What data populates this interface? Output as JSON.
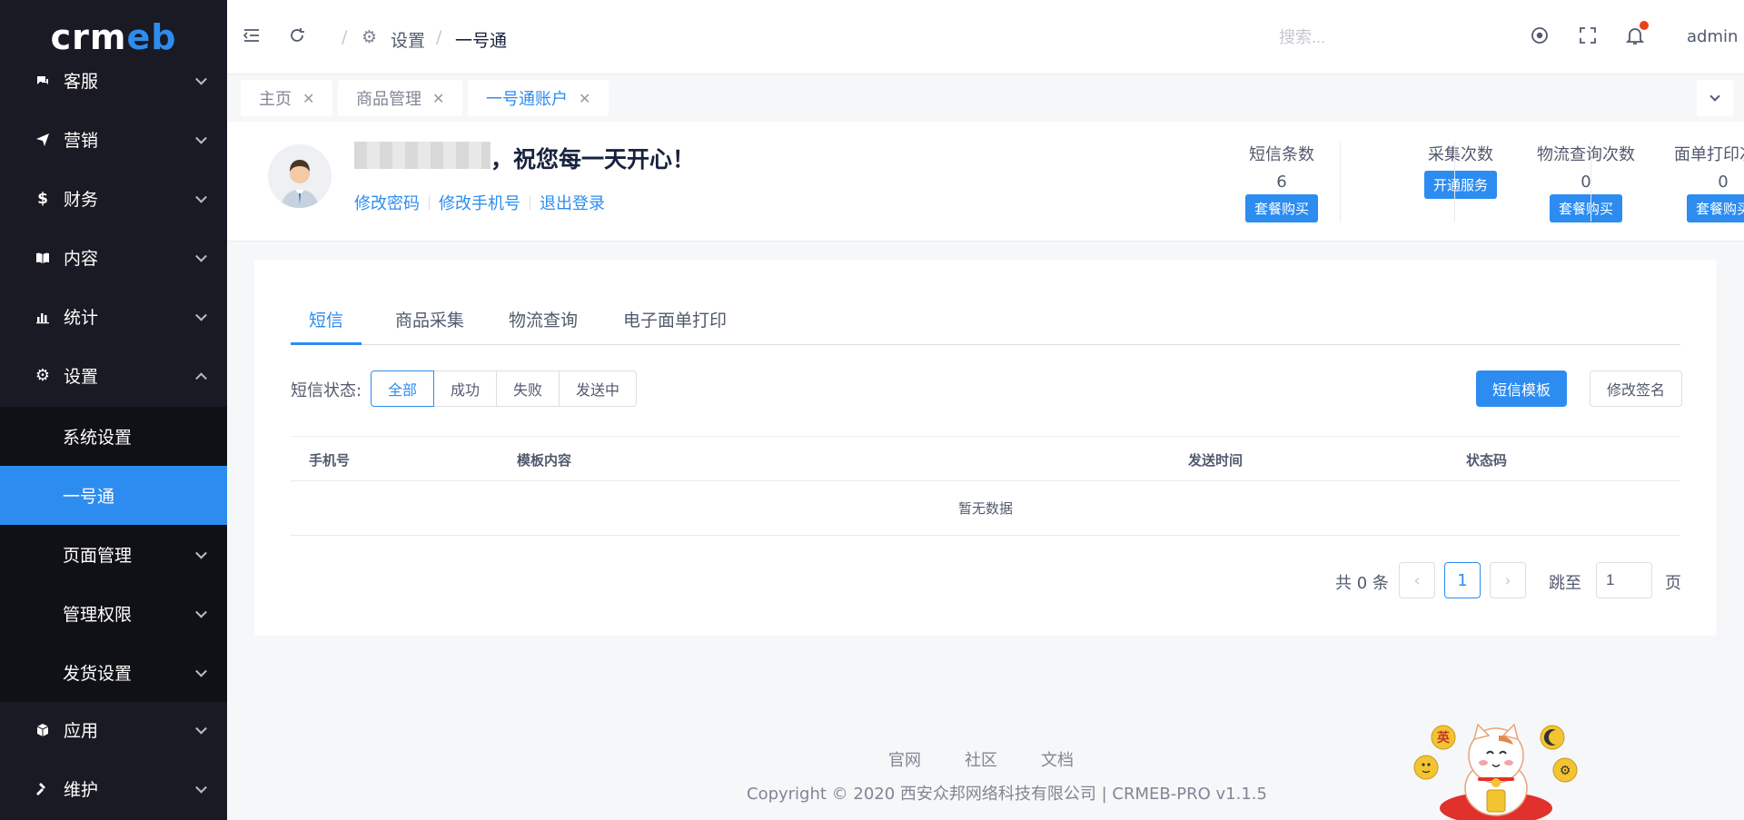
{
  "brand": {
    "logo_text_a": "crm",
    "logo_text_b": "eb"
  },
  "sidebar": {
    "items": [
      {
        "label": "客服",
        "icon": "chat-icon"
      },
      {
        "label": "营销",
        "icon": "send-icon"
      },
      {
        "label": "财务",
        "icon": "dollar-icon"
      },
      {
        "label": "内容",
        "icon": "book-icon"
      },
      {
        "label": "统计",
        "icon": "bar-chart-icon"
      },
      {
        "label": "设置",
        "icon": "gear-icon"
      }
    ],
    "settings_sub": [
      {
        "label": "系统设置"
      },
      {
        "label": "一号通"
      },
      {
        "label": "页面管理"
      },
      {
        "label": "管理权限"
      },
      {
        "label": "发货设置"
      }
    ],
    "after_items": [
      {
        "label": "应用",
        "icon": "cube-icon"
      },
      {
        "label": "维护",
        "icon": "hammer-icon"
      }
    ]
  },
  "header": {
    "breadcrumb": [
      "设置",
      "一号通"
    ],
    "search_placeholder": "搜索...",
    "user": "admin"
  },
  "tabs": [
    {
      "label": "主页"
    },
    {
      "label": "商品管理"
    },
    {
      "label": "一号通账户"
    }
  ],
  "profile": {
    "greeting": "，祝您每一天开心！",
    "links": [
      "修改密码",
      "修改手机号",
      "退出登录"
    ],
    "stats": [
      {
        "label": "短信条数",
        "value": "6",
        "button": "套餐购买"
      },
      {
        "label": "采集次数",
        "value": "",
        "button": "开通服务"
      },
      {
        "label": "物流查询次数",
        "value": "0",
        "button": "套餐购买"
      },
      {
        "label": "面单打印次数",
        "value": "0",
        "button": "套餐购买"
      }
    ]
  },
  "main": {
    "tabs": [
      "短信",
      "商品采集",
      "物流查询",
      "电子面单打印"
    ],
    "filter_label": "短信状态:",
    "filters": [
      "全部",
      "成功",
      "失败",
      "发送中"
    ],
    "btn_template": "短信模板",
    "btn_signature": "修改签名",
    "columns": [
      "手机号",
      "模板内容",
      "发送时间",
      "状态码"
    ],
    "empty_text": "暂无数据",
    "pager": {
      "total": "共 0 条",
      "current": "1",
      "jump_label": "跳至",
      "jump_value": "1",
      "suffix": "页"
    }
  },
  "footer": {
    "links": [
      "官网",
      "社区",
      "文档"
    ],
    "copyright": "Copyright © 2020 西安众邦网络科技有限公司 | CRMEB-PRO v1.1.5"
  },
  "colors": {
    "primary": "#2d8cf0",
    "sidebar_bg": "#191a23",
    "submenu_bg": "#101117",
    "badge": "#ed4014"
  }
}
